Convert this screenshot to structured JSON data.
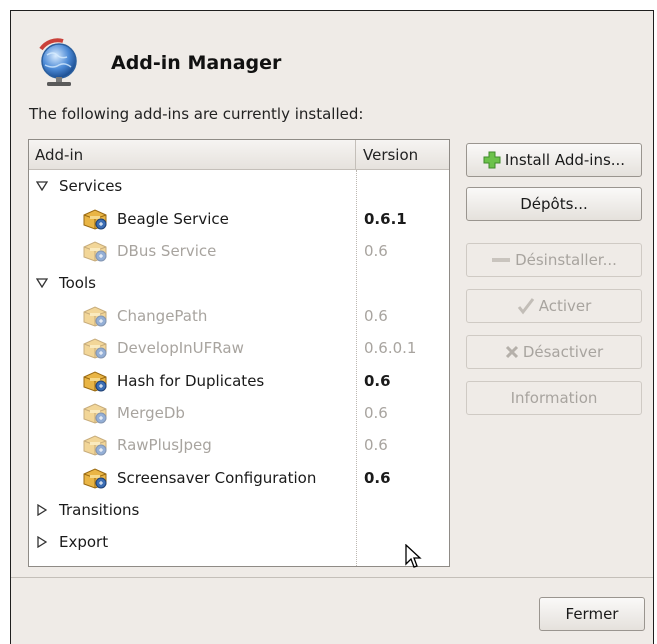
{
  "dialog": {
    "title": "Add-in Manager",
    "subtitle": "The following add-ins are currently installed:"
  },
  "list": {
    "columns": {
      "addin": "Add-in",
      "version": "Version"
    },
    "rows": [
      {
        "type": "group",
        "label": "Services",
        "expanded": true,
        "dim": false
      },
      {
        "type": "item",
        "label": "Beagle Service",
        "version": "0.6.1",
        "enabled": true
      },
      {
        "type": "item",
        "label": "DBus Service",
        "version": "0.6",
        "enabled": false
      },
      {
        "type": "group",
        "label": "Tools",
        "expanded": true,
        "dim": false
      },
      {
        "type": "item",
        "label": "ChangePath",
        "version": "0.6",
        "enabled": false
      },
      {
        "type": "item",
        "label": "DevelopInUFRaw",
        "version": "0.6.0.1",
        "enabled": false
      },
      {
        "type": "item",
        "label": "Hash for Duplicates",
        "version": "0.6",
        "enabled": true
      },
      {
        "type": "item",
        "label": "MergeDb",
        "version": "0.6",
        "enabled": false
      },
      {
        "type": "item",
        "label": "RawPlusJpeg",
        "version": "0.6",
        "enabled": false
      },
      {
        "type": "item",
        "label": "Screensaver Configuration",
        "version": "0.6",
        "enabled": true
      },
      {
        "type": "group",
        "label": "Transitions",
        "expanded": false,
        "dim": false
      },
      {
        "type": "group",
        "label": "Export",
        "expanded": false,
        "dim": false
      }
    ]
  },
  "buttons": {
    "install": "Install Add-ins...",
    "repositories": "Dépôts...",
    "uninstall": "Désinstaller...",
    "activate": "Activer",
    "deactivate": "Désactiver",
    "information": "Information",
    "close": "Fermer"
  },
  "colors": {
    "dialog_bg": "#efebe7",
    "disabled_text": "#a8a49f",
    "accent_green": "#5cb03a"
  }
}
